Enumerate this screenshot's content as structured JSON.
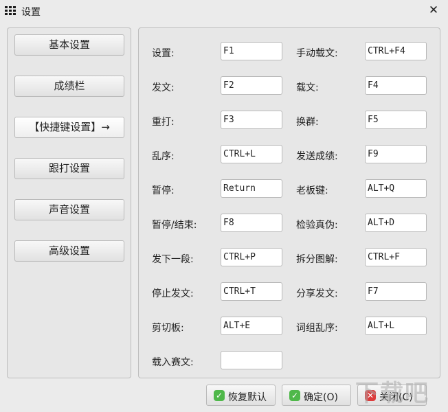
{
  "window": {
    "title": "设置",
    "close_label": "✕"
  },
  "nav": [
    {
      "label": "基本设置",
      "active": false
    },
    {
      "label": "成绩栏",
      "active": false
    },
    {
      "label": "【快捷键设置】→",
      "active": true
    },
    {
      "label": "跟打设置",
      "active": false
    },
    {
      "label": "声音设置",
      "active": false
    },
    {
      "label": "高级设置",
      "active": false
    }
  ],
  "shortcuts_left": [
    {
      "label": "设置:",
      "value": "F1"
    },
    {
      "label": "发文:",
      "value": "F2"
    },
    {
      "label": "重打:",
      "value": "F3"
    },
    {
      "label": "乱序:",
      "value": "CTRL+L"
    },
    {
      "label": "暂停:",
      "value": "Return"
    },
    {
      "label": "暂停/结束:",
      "value": "F8"
    },
    {
      "label": "发下一段:",
      "value": "CTRL+P"
    },
    {
      "label": "停止发文:",
      "value": "CTRL+T"
    },
    {
      "label": "剪切板:",
      "value": "ALT+E"
    },
    {
      "label": "载入赛文:",
      "value": ""
    }
  ],
  "shortcuts_right": [
    {
      "label": "手动载文:",
      "value": "CTRL+F4"
    },
    {
      "label": "载文:",
      "value": "F4"
    },
    {
      "label": "换群:",
      "value": "F5"
    },
    {
      "label": "发送成绩:",
      "value": "F9"
    },
    {
      "label": "老板键:",
      "value": "ALT+Q"
    },
    {
      "label": "检验真伪:",
      "value": "ALT+D"
    },
    {
      "label": "拆分图解:",
      "value": "CTRL+F"
    },
    {
      "label": "分享发文:",
      "value": "F7"
    },
    {
      "label": "词组乱序:",
      "value": "ALT+L"
    }
  ],
  "buttons": {
    "restore": "恢复默认",
    "ok": "确定(O)",
    "close": "关闭(C)"
  },
  "watermark": "下载吧"
}
